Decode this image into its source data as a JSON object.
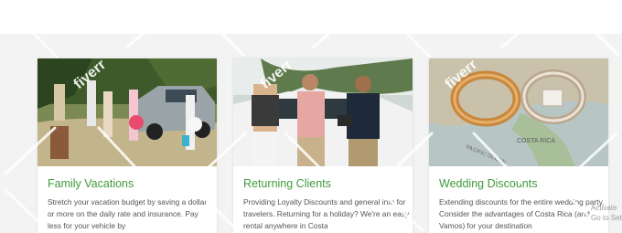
{
  "cards": [
    {
      "title": "Family Vacations",
      "description": "Stretch your vacation budget by saving a dollar or more on the daily rate and insurance. Pay less for your vehicle by",
      "photo": "family-vacation-photo"
    },
    {
      "title": "Returning Clients",
      "description": "Providing Loyalty Discounts and general info for travelers. Returning for a holiday? We're an easy rental anywhere in Costa",
      "photo": "returning-clients-photo"
    },
    {
      "title": "Wedding Discounts",
      "description": "Extending discounts for the entire wedding party. Consider the advantages of Costa Rica (and Vamos) for your destination",
      "photo": "wedding-rings-photo"
    }
  ],
  "colors": {
    "title_green": "#3f9a3c",
    "page_background": "#f3f3f3"
  },
  "map_text": [
    "PACIFIC OCEAN",
    "COSTA RICA"
  ],
  "watermark_text": "fiverr",
  "activate_notice": "Activate\nGo to Settin"
}
